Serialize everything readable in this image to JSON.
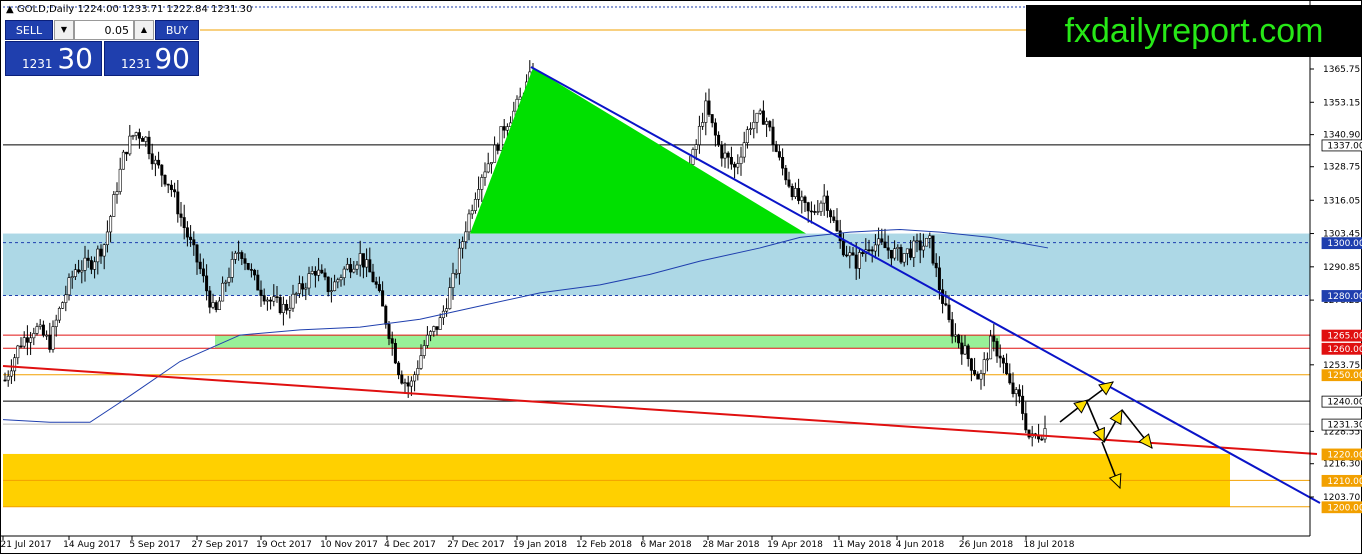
{
  "header": {
    "symbol": "GOLD,Daily",
    "ohlc": "1224.00 1233.71 1222.84 1231.30"
  },
  "trade_panel": {
    "sell_label": "SELL",
    "buy_label": "BUY",
    "lot_size": "0.05",
    "sell_price_small": "1231",
    "sell_price_big": "30",
    "buy_price_small": "1231",
    "buy_price_big": "90"
  },
  "brand": {
    "text": "fxdailyreport.com"
  },
  "chart_data": {
    "type": "candlestick",
    "y_axis_ticks": [
      "1365.75",
      "1353.15",
      "1340.90",
      "1328.75",
      "1316.05",
      "1303.45",
      "1290.85",
      "1278.25",
      "1253.75",
      "1228.55",
      "1216.30",
      "1203.70"
    ],
    "x_axis_ticks": [
      "21 Jul 2017",
      "14 Aug 2017",
      "5 Sep 2017",
      "27 Sep 2017",
      "19 Oct 2017",
      "10 Nov 2017",
      "4 Dec 2017",
      "27 Dec 2017",
      "19 Jan 2018",
      "12 Feb 2018",
      "6 Mar 2018",
      "28 Mar 2018",
      "19 Apr 2018",
      "11 May 2018",
      "4 Jun 2018",
      "26 Jun 2018",
      "18 Jul 2018"
    ],
    "price_tags": [
      {
        "text": "1337.00",
        "bg": "#ffffff",
        "fg": "#000000"
      },
      {
        "text": "1300.00",
        "bg": "#1f3fae",
        "fg": "#ffffff"
      },
      {
        "text": "1280.00",
        "bg": "#1f3fae",
        "fg": "#ffffff"
      },
      {
        "text": "1265.00",
        "bg": "#e01010",
        "fg": "#ffffff"
      },
      {
        "text": "1260.00",
        "bg": "#e01010",
        "fg": "#ffffff"
      },
      {
        "text": "1250.00",
        "bg": "#f2a000",
        "fg": "#ffffff"
      },
      {
        "text": "1240.00",
        "bg": "#ffffff",
        "fg": "#000000"
      },
      {
        "text": "1231.30",
        "bg": "#ffffff",
        "fg": "#000000"
      },
      {
        "text": "1220.00",
        "bg": "#f2a000",
        "fg": "#ffffff"
      },
      {
        "text": "1210.00",
        "bg": "#f2a000",
        "fg": "#ffffff"
      },
      {
        "text": "1200.00",
        "bg": "#f2a000",
        "fg": "#ffffff"
      }
    ],
    "colors": {
      "resistance_zone": "#add8e6",
      "support_green": "#98f098",
      "support_yellow": "#ffd000",
      "triangle": "#00e000",
      "downtrend": "#0a14c8",
      "red_trend": "#e01010",
      "moving_average": "#1f3fae"
    }
  }
}
